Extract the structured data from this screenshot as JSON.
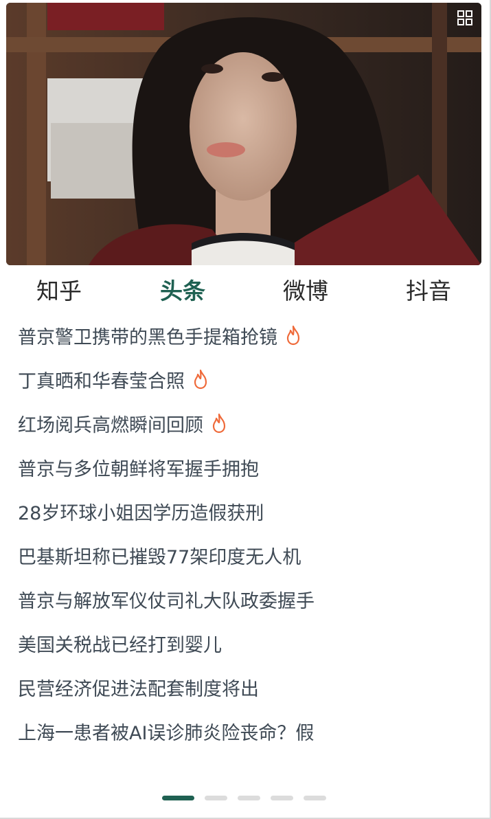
{
  "colors": {
    "accent": "#1f6152",
    "text": "#3f4a55",
    "hot": "#ef6a3a",
    "dot_inactive": "#dcdcdc"
  },
  "banner": {
    "icon": "grid-icon",
    "image": "portrait-photo"
  },
  "tabs": [
    {
      "label": "知乎",
      "active": false
    },
    {
      "label": "头条",
      "active": true
    },
    {
      "label": "微博",
      "active": false
    },
    {
      "label": "抖音",
      "active": false
    }
  ],
  "items": [
    {
      "title": "普京警卫携带的黑色手提箱抢镜",
      "hot": true
    },
    {
      "title": "丁真晒和华春莹合照",
      "hot": true
    },
    {
      "title": "红场阅兵高燃瞬间回顾",
      "hot": true
    },
    {
      "title": "普京与多位朝鲜将军握手拥抱",
      "hot": false
    },
    {
      "title": "28岁环球小姐因学历造假获刑",
      "hot": false
    },
    {
      "title": "巴基斯坦称已摧毁77架印度无人机",
      "hot": false
    },
    {
      "title": "普京与解放军仪仗司礼大队政委握手",
      "hot": false
    },
    {
      "title": "美国关税战已经打到婴儿",
      "hot": false
    },
    {
      "title": "民营经济促进法配套制度将出",
      "hot": false
    },
    {
      "title": "上海一患者被AI误诊肺炎险丧命？假",
      "hot": false
    }
  ],
  "pagination": {
    "pages": 5,
    "current": 1
  }
}
